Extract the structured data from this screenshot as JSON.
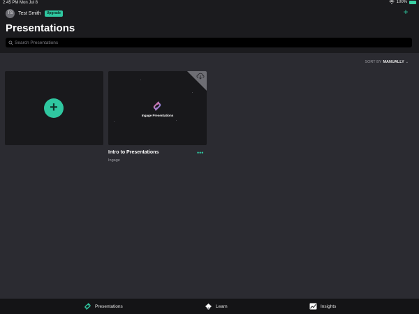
{
  "status": {
    "time": "2:45 PM",
    "date": "Mon Jul 8",
    "battery": "100%"
  },
  "user": {
    "initials": "TS",
    "name": "Test Smith",
    "badge": "Upgrade"
  },
  "page": {
    "title": "Presentations"
  },
  "search": {
    "placeholder": "Search Presentations"
  },
  "sort": {
    "label": "SORT BY",
    "value": "MANUALLY"
  },
  "presentations": [
    {
      "thumbnail_text": "Ingage Presentations",
      "title": "Intro to Presentations",
      "subtitle": "Ingage"
    }
  ],
  "tabs": [
    {
      "label": "Presentations",
      "icon": "ingage-logo-icon"
    },
    {
      "label": "Learn",
      "icon": "learn-icon"
    },
    {
      "label": "Insights",
      "icon": "insights-icon"
    }
  ],
  "colors": {
    "accent": "#2fc7a0",
    "header_bg": "#1b1b1e",
    "content_bg": "#2b2b31",
    "card_bg": "#19191c"
  }
}
